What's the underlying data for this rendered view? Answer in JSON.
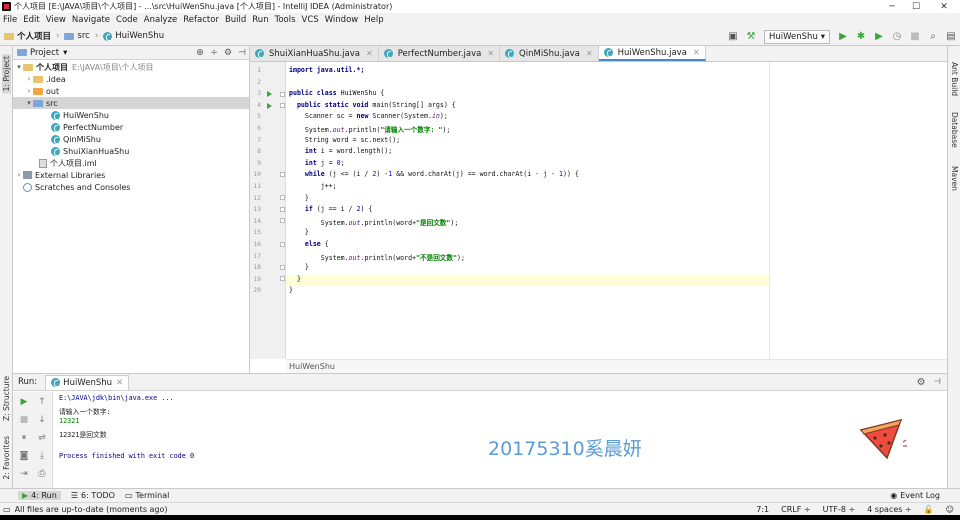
{
  "window": {
    "title": "个人项目 [E:\\JAVA\\项目\\个人项目] - ...\\src\\HuiWenShu.java [个人项目] - IntelliJ IDEA (Administrator)"
  },
  "menu": [
    "File",
    "Edit",
    "View",
    "Navigate",
    "Code",
    "Analyze",
    "Refactor",
    "Build",
    "Run",
    "Tools",
    "VCS",
    "Window",
    "Help"
  ],
  "navbar": {
    "crumb1": "个人项目",
    "crumb2": "src",
    "crumb3": "HuiWenShu",
    "run_config": "HuiWenShu"
  },
  "left_strip": {
    "project": "1: Project",
    "structure": "Z: Structure",
    "favorites": "2: Favorites"
  },
  "right_strip": {
    "ant": "Ant Build",
    "database": "Database",
    "maven": "Maven"
  },
  "project_panel": {
    "title": "Project",
    "root_label": "个人项目",
    "root_path": "E:\\JAVA\\项目\\个人项目",
    "idea": ".idea",
    "out": "out",
    "src": "src",
    "classes": [
      "HuiWenShu",
      "PerfectNumber",
      "QinMiShu",
      "ShuiXianHuaShu"
    ],
    "iml": "个人项目.iml",
    "ext_libs": "External Libraries",
    "scratches": "Scratches and Consoles"
  },
  "tabs": [
    "ShuiXianHuaShu.java",
    "PerfectNumber.java",
    "QinMiShu.java",
    "HuiWenShu.java"
  ],
  "line_numbers": [
    "1",
    "2",
    "3",
    "4",
    "5",
    "6",
    "7",
    "8",
    "9",
    "10",
    "11",
    "12",
    "13",
    "14",
    "15",
    "16",
    "17",
    "18",
    "19",
    "20"
  ],
  "code": {
    "l1": "import java.util.*;",
    "l3a": "public class",
    "l3b": " HuiWenShu {",
    "l4a": "  public static void",
    "l4b": " main(String[] args) {",
    "l5a": "    Scanner sc = ",
    "l5b": "new",
    "l5c": " Scanner(System.",
    "l5d": "in",
    "l5e": ");",
    "l6a": "    System.",
    "l6b": "out",
    "l6c": ".println(",
    "l6d": "\"请输入一个数字: \"",
    "l6e": ");",
    "l7": "    String word = sc.next();",
    "l8a": "    int",
    "l8b": " i = word.length();",
    "l9a": "    int",
    "l9b": " j = ",
    "l9c": "0",
    "l9d": ";",
    "l10a": "    while",
    "l10b": " (j <= (i / ",
    "l10c": "2",
    "l10d": ") -",
    "l10e": "1",
    "l10f": " && word.charAt(j) == word.charAt(i - j - ",
    "l10g": "1",
    "l10h": ")) {",
    "l11": "        j++;",
    "l12": "    }",
    "l13a": "    if",
    "l13b": " (j == i / ",
    "l13c": "2",
    "l13d": ") {",
    "l14a": "        System.",
    "l14b": "out",
    "l14c": ".println(word+",
    "l14d": "\"是回文数\"",
    "l14e": ");",
    "l15": "    }",
    "l16a": "    else",
    "l16b": " {",
    "l17a": "        System.",
    "l17b": "out",
    "l17c": ".println(word+",
    "l17d": "\"不是回文数\"",
    "l17e": ");",
    "l18": "    }",
    "l19": "  }",
    "l20": "}"
  },
  "editor_breadcrumb": "HuiWenShu",
  "run_panel": {
    "title": "Run:",
    "tab": "HuiWenShu",
    "lines": {
      "cmd": "E:\\JAVA\\jdk\\bin\\java.exe ...",
      "prompt": "请输入一个数字:",
      "input": "12321",
      "result": "12321是回文数",
      "exit": "Process finished with exit code 0"
    },
    "watermark": "20175310奚晨妍"
  },
  "bottom_tools": {
    "run": "4: Run",
    "todo": "6: TODO",
    "terminal": "Terminal",
    "event_log": "Event Log"
  },
  "status": {
    "message": "All files are up-to-date (moments ago)",
    "position": "7:1",
    "line_sep": "CRLF ÷",
    "encoding": "UTF-8 ÷",
    "indent": "4 spaces ÷"
  }
}
